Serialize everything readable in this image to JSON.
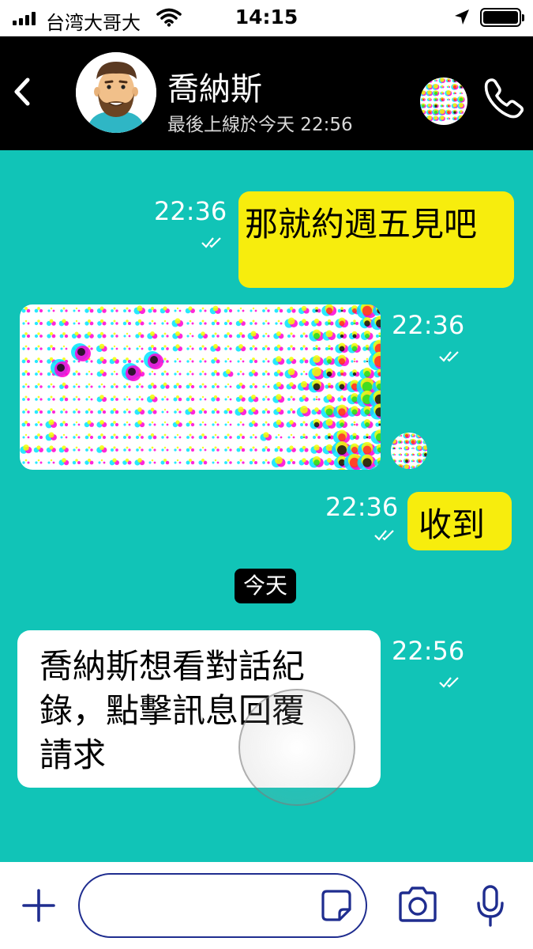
{
  "status_bar": {
    "carrier": "台湾大哥大",
    "time": "14:15",
    "signal_bars": 4,
    "battery_level": 1.0,
    "icons": [
      "signal-icon",
      "wifi-icon",
      "location-arrow-icon",
      "battery-icon"
    ]
  },
  "header": {
    "back_icon": "chevron-left-icon",
    "contact_name": "喬納斯",
    "last_seen": "最後上線於今天 22:56",
    "avatar_icon": "bearded-man-avatar",
    "group_avatar_icon": "halftone-dots-avatar",
    "call_icon": "phone-icon"
  },
  "messages": [
    {
      "direction": "outgoing",
      "type": "text",
      "text": "那就約週五見吧",
      "time": "22:36",
      "status": "read"
    },
    {
      "direction": "incoming",
      "type": "image",
      "image": "halftone-dot-pattern",
      "time": "22:36",
      "status": "read"
    },
    {
      "direction": "outgoing",
      "type": "text",
      "text": "收到",
      "time": "22:36",
      "status": "read"
    },
    {
      "type": "date-separator",
      "text": "今天"
    },
    {
      "direction": "incoming",
      "type": "text",
      "text": "喬納斯想看對話紀錄，點擊訊息回覆請求",
      "time": "22:56",
      "status": "read"
    }
  ],
  "composer": {
    "plus_icon": "plus-icon",
    "input_value": "",
    "input_placeholder": "",
    "sticker_icon": "sticker-icon",
    "camera_icon": "camera-icon",
    "mic_icon": "microphone-icon"
  },
  "colors": {
    "chat_background": "#11c4b7",
    "header_background": "#000000",
    "outgoing_bubble": "#f7ed0d",
    "incoming_bubble": "#ffffff",
    "accent_icon": "#1f2d8f"
  }
}
